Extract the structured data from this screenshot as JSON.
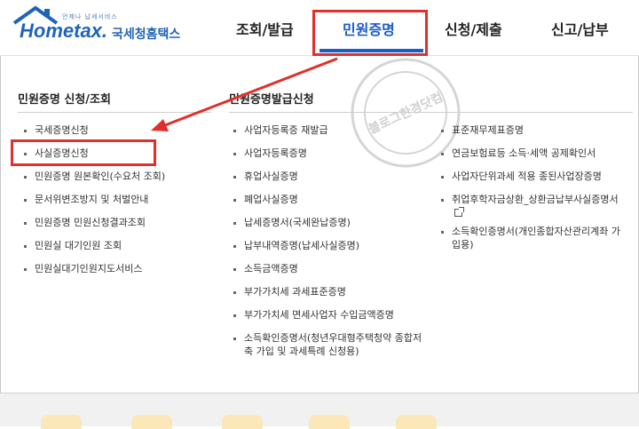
{
  "header": {
    "logo_tagline": "언제나 납세서비스",
    "logo_brand": "Hometax.",
    "logo_kr": "국세청홈택스",
    "nav": [
      {
        "label": "조회/발급",
        "active": false
      },
      {
        "label": "민원증명",
        "active": true
      },
      {
        "label": "신청/제출",
        "active": false
      },
      {
        "label": "신고/납부",
        "active": false
      }
    ]
  },
  "menu": {
    "section1_title": "민원증명 신청/조회",
    "section2_title": "민원증명발급신청",
    "col1": [
      "국세증명신청",
      "사실증명신청",
      "민원증명 원본확인(수요처 조회)",
      "문서위변조방지 및 처벌안내",
      "민원증명 민원신청결과조회",
      "민원실 대기인원 조회",
      "민원실대기인원지도서비스"
    ],
    "col2": [
      "사업자등록증 재발급",
      "사업자등록증명",
      "휴업사실증명",
      "폐업사실증명",
      "납세증명서(국세완납증명)",
      "납부내역증명(납세사실증명)",
      "소득금액증명",
      "부가가치세 과세표준증명",
      "부가가치세 면세사업자 수입금액증명",
      "소득확인증명서(청년우대형주택청약 종합저축 가입 및 과세특례 신청용)"
    ],
    "col3": [
      "표준재무제표증명",
      "연금보험료등 소득·세액 공제확인서",
      "사업자단위과세 적용 종된사업장증명",
      "취업후학자금상환_상환금납부사실증명서",
      "소득확인증명서(개인종합자산관리계좌 가입용)"
    ]
  },
  "watermark": {
    "text": "블로그한경닷컴"
  },
  "colors": {
    "brand_blue": "#1f64b6",
    "active_nav": "#1a5cc8",
    "highlight_red": "#e0302c"
  }
}
